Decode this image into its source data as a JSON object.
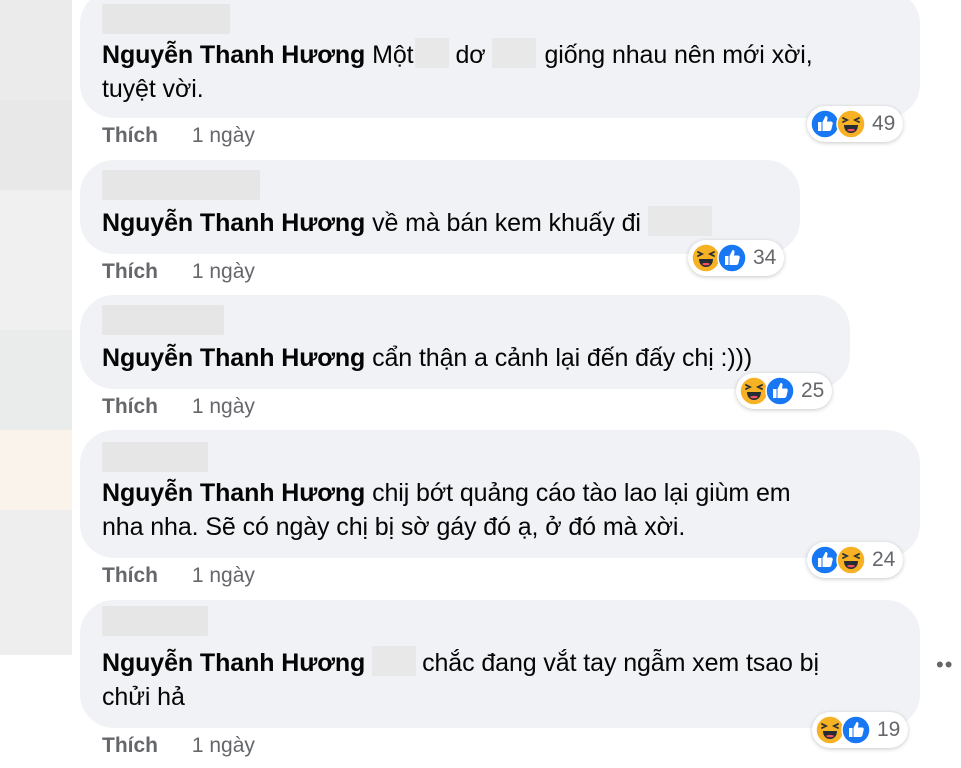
{
  "comments": [
    {
      "author": "Nguyễn Thanh Hương",
      "parts": [
        "Một",
        "dơ",
        "giống nhau nên mới xời,"
      ],
      "line2": "tuyệt vời.",
      "like_label": "Thích",
      "time": "1 ngày",
      "reaction_count": "49",
      "reactions": [
        "like",
        "haha"
      ]
    },
    {
      "author": "Nguyễn Thanh Hương",
      "text": "về mà bán kem khuấy đi",
      "like_label": "Thích",
      "time": "1 ngày",
      "reaction_count": "34",
      "reactions": [
        "haha",
        "like"
      ]
    },
    {
      "author": "Nguyễn Thanh Hương",
      "text": "cẩn thận a cảnh lại đến đấy chị :)))",
      "like_label": "Thích",
      "time": "1 ngày",
      "reaction_count": "25",
      "reactions": [
        "haha",
        "like"
      ]
    },
    {
      "author": "Nguyễn Thanh Hương",
      "text": "chij bớt quảng cáo tào lao lại giùm em",
      "line2": "nha nha. Sẽ có ngày chị bị sờ gáy đó ạ, ở đó mà xời.",
      "like_label": "Thích",
      "time": "1 ngày",
      "reaction_count": "24",
      "reactions": [
        "like",
        "haha"
      ]
    },
    {
      "author": "Nguyễn Thanh Hương",
      "text": "chắc đang vắt tay ngẫm xem tsao bị",
      "line2": "chửi hả",
      "like_label": "Thích",
      "time": "1 ngày",
      "reaction_count": "19",
      "reactions": [
        "haha",
        "like"
      ]
    }
  ],
  "more_label": "••",
  "colors": {
    "bubble": "#f0f2f5",
    "meta": "#65676b",
    "like_blue": "#1877f2",
    "haha_yellow": "#f7b125"
  }
}
